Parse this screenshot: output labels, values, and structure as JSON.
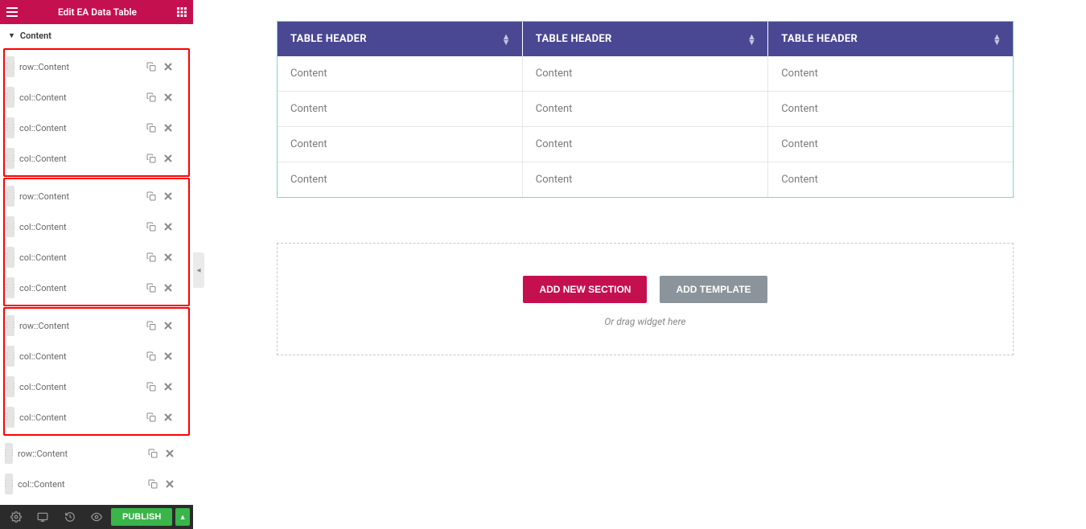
{
  "header": {
    "title": "Edit EA Data Table"
  },
  "panel": {
    "section_label": "Content",
    "groups": [
      {
        "framed": true,
        "items": [
          {
            "label": "row::Content"
          },
          {
            "label": "col::Content"
          },
          {
            "label": "col::Content"
          },
          {
            "label": "col::Content"
          }
        ]
      },
      {
        "framed": true,
        "items": [
          {
            "label": "row::Content"
          },
          {
            "label": "col::Content"
          },
          {
            "label": "col::Content"
          },
          {
            "label": "col::Content"
          }
        ]
      },
      {
        "framed": true,
        "items": [
          {
            "label": "row::Content"
          },
          {
            "label": "col::Content"
          },
          {
            "label": "col::Content"
          },
          {
            "label": "col::Content"
          }
        ]
      },
      {
        "framed": false,
        "items": [
          {
            "label": "row::Content"
          },
          {
            "label": "col::Content"
          }
        ]
      }
    ]
  },
  "footer": {
    "publish_label": "PUBLISH"
  },
  "table": {
    "headers": [
      "TABLE HEADER",
      "TABLE HEADER",
      "TABLE HEADER"
    ],
    "rows": [
      [
        "Content",
        "Content",
        "Content"
      ],
      [
        "Content",
        "Content",
        "Content"
      ],
      [
        "Content",
        "Content",
        "Content"
      ],
      [
        "Content",
        "Content",
        "Content"
      ]
    ]
  },
  "dropzone": {
    "add_section_label": "ADD NEW SECTION",
    "add_template_label": "ADD TEMPLATE",
    "hint": "Or drag widget here"
  }
}
